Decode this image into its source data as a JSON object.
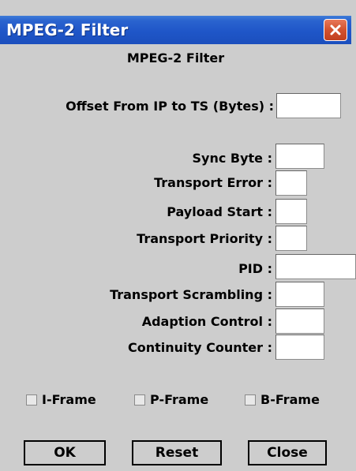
{
  "window": {
    "title": "MPEG-2 Filter",
    "heading": "MPEG-2 Filter"
  },
  "fields": {
    "offset": {
      "label": "Offset From IP to TS (Bytes) :",
      "value": ""
    },
    "sync_byte": {
      "label": "Sync Byte :",
      "value": ""
    },
    "transport_error": {
      "label": "Transport Error :",
      "value": ""
    },
    "payload_start": {
      "label": "Payload Start :",
      "value": ""
    },
    "transport_priority": {
      "label": "Transport Priority :",
      "value": ""
    },
    "pid": {
      "label": "PID :",
      "value": ""
    },
    "transport_scrambling": {
      "label": "Transport Scrambling :",
      "value": ""
    },
    "adaption_control": {
      "label": "Adaption Control :",
      "value": ""
    },
    "continuity_counter": {
      "label": "Continuity Counter :",
      "value": ""
    }
  },
  "frames": [
    {
      "label": "I-Frame",
      "checked": false
    },
    {
      "label": "P-Frame",
      "checked": false
    },
    {
      "label": "B-Frame",
      "checked": false
    }
  ],
  "buttons": {
    "ok": "OK",
    "reset": "Reset",
    "close": "Close"
  },
  "colors": {
    "titlebar": "#2a63cf",
    "dialog_bg": "#cdcdcd",
    "close_button": "#d2512f"
  },
  "icons": {
    "close": "close-x-icon"
  }
}
